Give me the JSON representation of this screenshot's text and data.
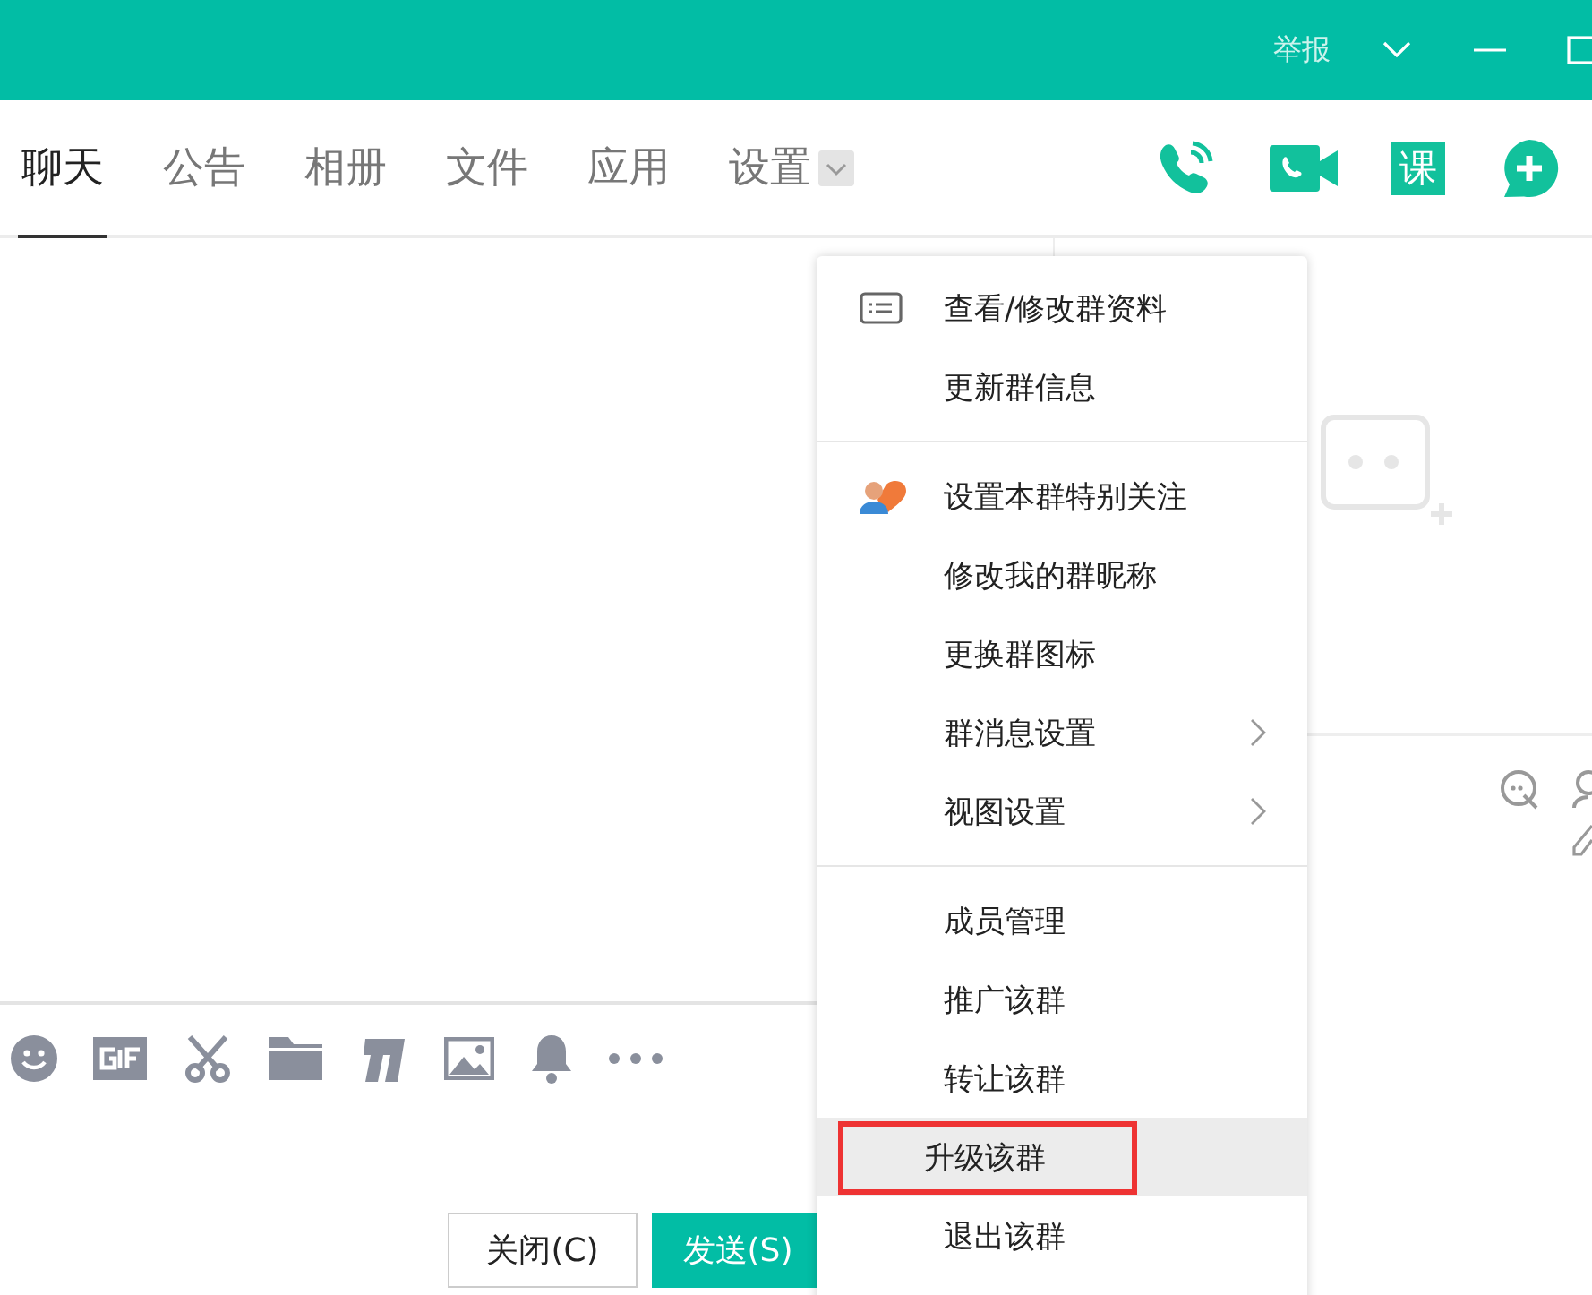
{
  "title_bar": {
    "report": "举报"
  },
  "tabs": [
    {
      "label": "聊天",
      "selected": true,
      "dropdown": false
    },
    {
      "label": "公告",
      "selected": false,
      "dropdown": false
    },
    {
      "label": "相册",
      "selected": false,
      "dropdown": false
    },
    {
      "label": "文件",
      "selected": false,
      "dropdown": false
    },
    {
      "label": "应用",
      "selected": false,
      "dropdown": false
    },
    {
      "label": "设置",
      "selected": false,
      "dropdown": true
    }
  ],
  "toolbar_actions": [
    {
      "kind": "phone"
    },
    {
      "kind": "video"
    },
    {
      "kind": "text",
      "label": "课"
    },
    {
      "kind": "add"
    }
  ],
  "buttons": [
    {
      "label": "关闭(C)",
      "primary": false
    },
    {
      "label": "发送(S)",
      "primary": true
    }
  ],
  "menu": {
    "groups": [
      [
        {
          "label": "查看/修改群资料",
          "kind": "card",
          "submenu": false,
          "highlighted": false,
          "marked": false
        },
        {
          "label": "更新群信息",
          "kind": "plain",
          "submenu": false,
          "highlighted": false,
          "marked": false
        }
      ],
      [
        {
          "label": "设置本群特别关注",
          "kind": "follow",
          "submenu": false,
          "highlighted": false,
          "marked": false
        },
        {
          "label": "修改我的群昵称",
          "kind": "plain",
          "submenu": false,
          "highlighted": false,
          "marked": false
        },
        {
          "label": "更换群图标",
          "kind": "plain",
          "submenu": false,
          "highlighted": false,
          "marked": false
        },
        {
          "label": "群消息设置",
          "kind": "plain",
          "submenu": true,
          "highlighted": false,
          "marked": false
        },
        {
          "label": "视图设置",
          "kind": "plain",
          "submenu": true,
          "highlighted": false,
          "marked": false
        }
      ],
      [
        {
          "label": "成员管理",
          "kind": "plain",
          "submenu": false,
          "highlighted": false,
          "marked": false
        },
        {
          "label": "推广该群",
          "kind": "plain",
          "submenu": false,
          "highlighted": false,
          "marked": false
        },
        {
          "label": "转让该群",
          "kind": "plain",
          "submenu": false,
          "highlighted": false,
          "marked": false
        },
        {
          "label": "升级该群",
          "kind": "plain",
          "submenu": false,
          "highlighted": true,
          "marked": true
        },
        {
          "label": "退出该群",
          "kind": "plain",
          "submenu": false,
          "highlighted": false,
          "marked": false
        }
      ]
    ]
  }
}
